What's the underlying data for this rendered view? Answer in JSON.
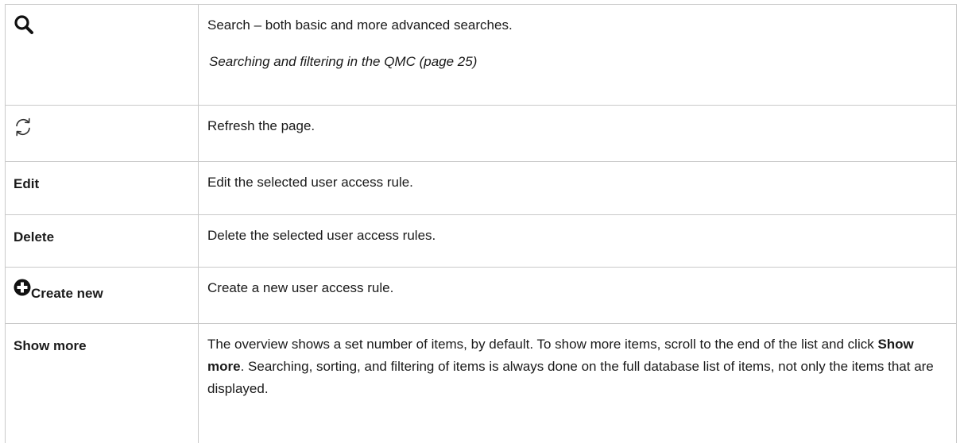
{
  "rows": [
    {
      "icon": "search-icon",
      "description": "Search – both basic and more advanced searches.",
      "link": "Searching and filtering in the QMC (page 25)"
    },
    {
      "icon": "refresh-icon",
      "description": "Refresh the page."
    },
    {
      "label": "Edit",
      "description": "Edit the selected user access rule."
    },
    {
      "label": "Delete",
      "description": "Delete the selected user access rules."
    },
    {
      "icon": "plus-circle-icon",
      "label": "Create new",
      "description": "Create a new user access rule."
    },
    {
      "label": "Show more",
      "description_parts": {
        "before": "The overview shows a set number of items, by default. To show more items, scroll to the end of the list and click ",
        "emphasis": "Show more",
        "after": ". Searching, sorting, and filtering of items is always done on the full database list of items, not only the items that are displayed."
      }
    }
  ]
}
